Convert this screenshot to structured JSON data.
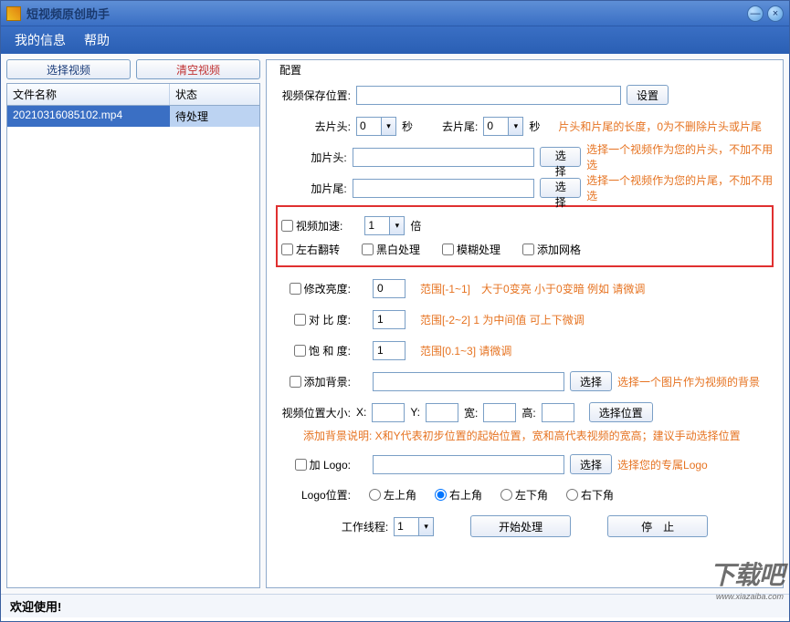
{
  "window": {
    "title": "短视频原创助手"
  },
  "menu": {
    "info": "我的信息",
    "help": "帮助"
  },
  "left": {
    "select_btn": "选择视频",
    "clear_btn": "清空视频",
    "th_name": "文件名称",
    "th_status": "状态",
    "row_name": "20210316085102.mp4",
    "row_status": "待处理"
  },
  "config": {
    "legend": "配置",
    "save_path_lbl": "视频保存位置:",
    "set_btn": "设置",
    "cut_head_lbl": "去片头:",
    "cut_head_val": "0",
    "sec": "秒",
    "cut_tail_lbl": "去片尾:",
    "cut_tail_val": "0",
    "cut_hint": "片头和片尾的长度，0为不删除片头或片尾",
    "add_head_lbl": "加片头:",
    "choose_btn": "选择",
    "add_head_hint": "选择一个视频作为您的片头，不加不用选",
    "add_tail_lbl": "加片尾:",
    "add_tail_hint": "选择一个视频作为您的片尾，不加不用选",
    "speed_lbl": "视频加速:",
    "speed_val": "1",
    "times": "倍",
    "flip_lbl": "左右翻转",
    "bw_lbl": "黑白处理",
    "blur_lbl": "模糊处理",
    "grid_lbl": "添加网格",
    "bright_lbl": "修改亮度:",
    "bright_val": "0",
    "bright_hint": "范围[-1~1]　大于0变亮 小于0变暗  例如 请微调",
    "contrast_lbl": "对 比  度:",
    "contrast_val": "1",
    "contrast_hint": "范围[-2~2]  1 为中间值  可上下微调",
    "sat_lbl": "饱 和  度:",
    "sat_val": "1",
    "sat_hint": "范围[0.1~3]  请微调",
    "bg_lbl": "添加背景:",
    "bg_hint": "选择一个图片作为视频的背景",
    "pos_lbl": "视频位置大小:",
    "x_lbl": "X:",
    "y_lbl": "Y:",
    "w_lbl": "宽:",
    "h_lbl": "高:",
    "pos_btn": "选择位置",
    "pos_hint": "添加背景说明:  X和Y代表初步位置的起始位置，宽和高代表视频的宽高；建议手动选择位置",
    "logo_lbl": "加 Logo:",
    "logo_hint": "选择您的专属Logo",
    "logo_pos_lbl": "Logo位置:",
    "tl": "左上角",
    "tr": "右上角",
    "bl": "左下角",
    "br": "右下角",
    "threads_lbl": "工作线程:",
    "threads_val": "1",
    "start_btn": "开始处理",
    "stop_btn": "停　止"
  },
  "status": "欢迎使用!",
  "watermark": {
    "main": "下载吧",
    "sub": "www.xiazaiba.com"
  }
}
